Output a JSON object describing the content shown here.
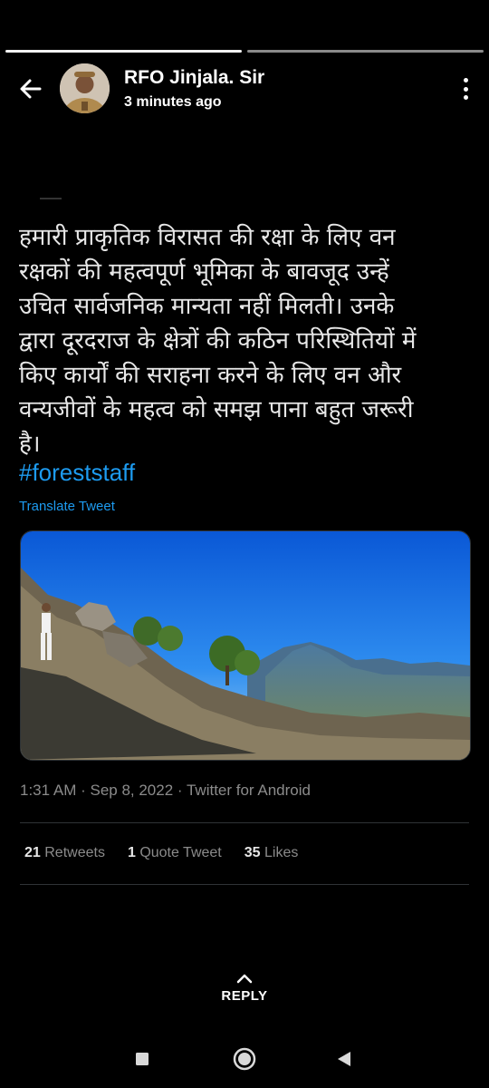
{
  "header": {
    "name": "RFO Jinjala. Sir",
    "time": "3 minutes ago",
    "back_icon": "arrow-left-icon",
    "more_icon": "more-vertical-icon"
  },
  "story_progress": {
    "segments": 2,
    "completed": 1
  },
  "tweet": {
    "lines": [
      "हमारी प्राकृतिक विरासत की रक्षा के लिए वन",
      "रक्षकों की महत्वपूर्ण भूमिका के बावजूद उन्हें",
      "उचित सार्वजनिक मान्यता नहीं मिलती। उनके",
      "द्वारा दूरदराज के क्षेत्रों की कठिन परिस्थितियों में",
      "किए कार्यों की सराहना करने के लिए वन और",
      "वन्यजीवों के महत्व को समझ पाना बहुत जरूरी",
      "है।"
    ],
    "hashtag": "#foreststaff",
    "translate_label": "Translate Tweet",
    "timestamp": "1:31 AM · Sep 8, 2022 · Twitter for Android",
    "stats": {
      "retweets_count": "21",
      "retweets_label": "Retweets",
      "quotes_count": "1",
      "quotes_label": "Quote Tweet",
      "likes_count": "35",
      "likes_label": "Likes"
    }
  },
  "reply": {
    "label": "REPLY",
    "icon": "chevron-up-icon"
  },
  "navbar": {
    "icons": [
      "recents-square-icon",
      "home-circle-icon",
      "back-triangle-icon"
    ]
  },
  "colors": {
    "background": "#000000",
    "link": "#1d9bf0",
    "muted": "#8b8b8b"
  }
}
